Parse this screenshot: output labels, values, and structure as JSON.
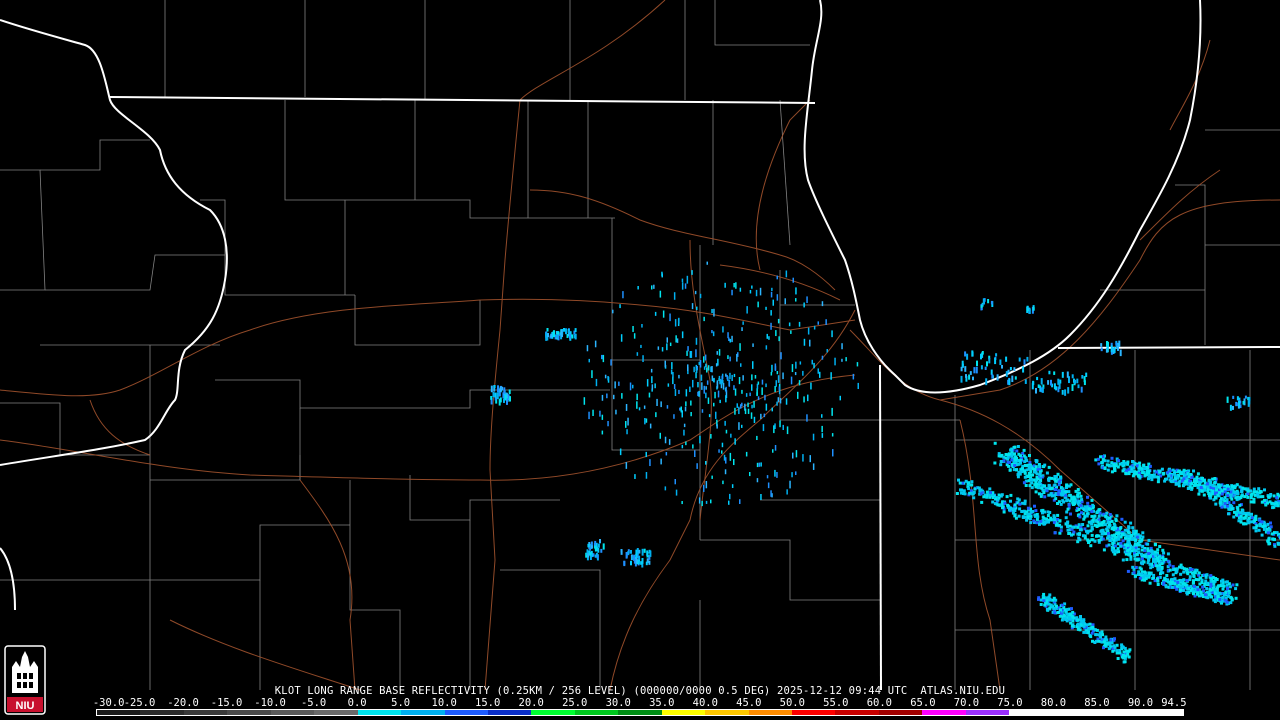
{
  "caption": "KLOT LONG RANGE BASE REFLECTIVITY (0.25KM / 256 LEVEL) (000000/0000 0.5 DEG) 2025-12-12 09:44 UTC  ATLAS.NIU.EDU",
  "scale": {
    "labels": [
      "-30.0",
      "-25.0",
      "-20.0",
      "-15.0",
      "-10.0",
      "-5.0",
      "0.0",
      "5.0",
      "10.0",
      "15.0",
      "20.0",
      "25.0",
      "30.0",
      "35.0",
      "40.0",
      "45.0",
      "50.0",
      "55.0",
      "60.0",
      "65.0",
      "70.0",
      "75.0",
      "80.0",
      "85.0",
      "90.0",
      "94.5"
    ],
    "colors": [
      "#1a1a1a",
      "#2b2b2b",
      "#3a3a3a",
      "#4a4a4a",
      "#5a5a5a",
      "#6a6a6a",
      "#00e5ee",
      "#00b0f0",
      "#1e5cff",
      "#0a2ec8",
      "#00ff30",
      "#00c81e",
      "#008c14",
      "#ffff00",
      "#ffc800",
      "#ff8c00",
      "#ff0000",
      "#c80000",
      "#a00000",
      "#ff00ff",
      "#9b30ff",
      "#ffffff",
      "#ffffff",
      "#ffffff",
      "#ffffff"
    ]
  },
  "logo": {
    "text": "NIU",
    "color": "#c8102e"
  }
}
